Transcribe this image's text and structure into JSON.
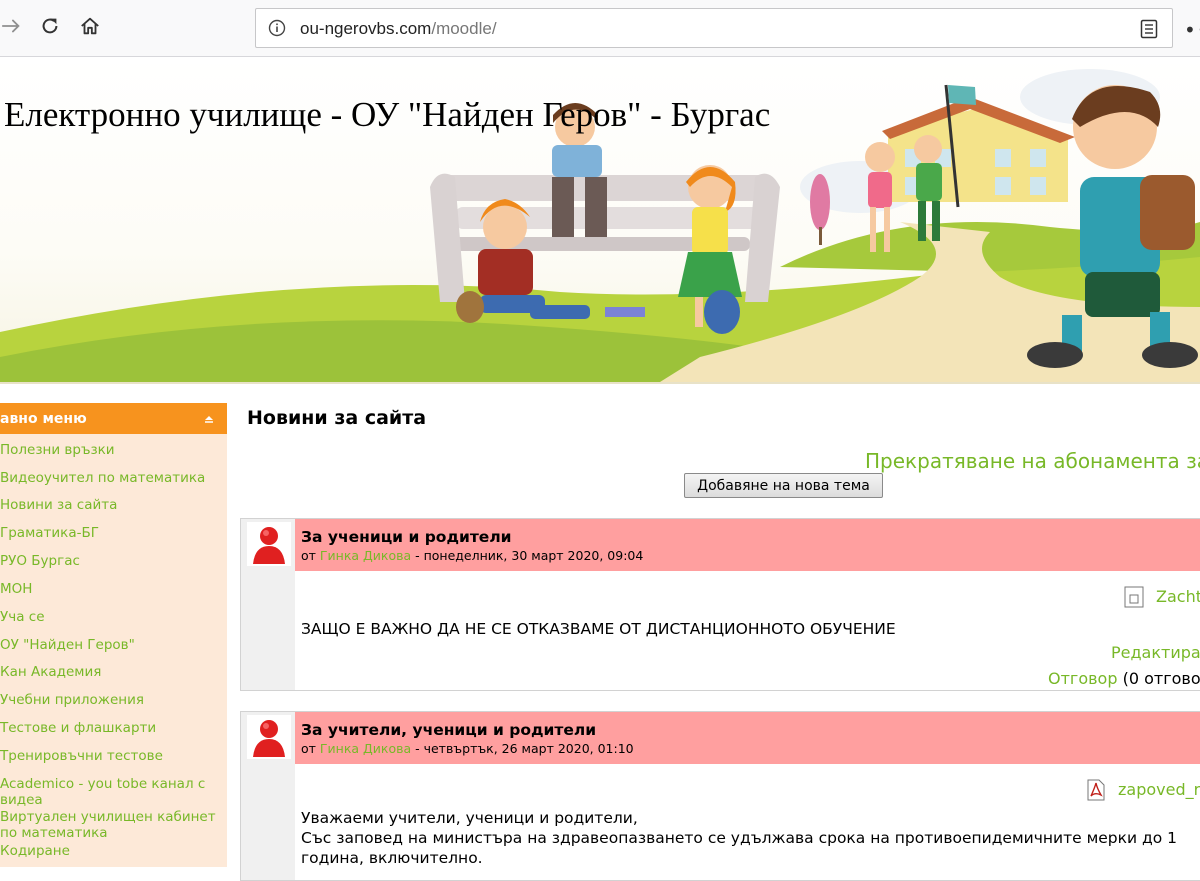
{
  "browser": {
    "url_domain": "ou-ngerovbs.com",
    "url_path": "/moodle/",
    "more_label": "•••"
  },
  "site": {
    "title": "Електронно училище - ОУ \"Найден Геров\" - Бургас"
  },
  "sidebar": {
    "header": "авно меню",
    "items": [
      "Полезни връзки",
      "Видеоучител по математика",
      "Новини за сайта",
      "Граматика-БГ",
      "РУО Бургас",
      "МОН",
      "Уча се",
      "ОУ \"Найден Геров\"",
      "Кан Академия",
      "Учебни приложения",
      "Тестове и флашкарти",
      "Тренировъчни тестове",
      "Academico - you tobe канал с видеа",
      "Виртуален училищен кабинет по математика",
      "Кодиране"
    ]
  },
  "main": {
    "heading": "Новини за сайта",
    "unsubscribe": "Прекратяване на абонамента за",
    "add_topic": "Добавяне на нова тема"
  },
  "posts": [
    {
      "subject": "За ученици и родители",
      "meta_prefix": "от ",
      "author": "Гинка Дикова",
      "meta_suffix": " - понеделник, 30 март 2020, 09:04",
      "attachment": "Zacht",
      "body_lines": [
        "ЗАЩО Е ВАЖНО ДА НЕ СЕ ОТКАЗВАМЕ ОТ ДИСТАНЦИОННОТО ОБУЧЕНИЕ"
      ],
      "edit_label": "Редактира",
      "reply_label": "Отговор",
      "reply_count": " (0 отговор"
    },
    {
      "subject": "За учители, ученици и родители",
      "meta_prefix": "от ",
      "author": "Гинка Дикова",
      "meta_suffix": " - четвъртък, 26 март 2020, 01:10",
      "attachment": "zapoved_r",
      "body_lines": [
        "Уважаеми учители, ученици и родители,",
        "Със заповед на министъра на здравеопазването се удължава срока на противоепидемичните мерки до 1",
        "година, включително."
      ]
    }
  ],
  "colors": {
    "link_green": "#78b828",
    "sidebar_header": "#f7931e",
    "sidebar_bg": "#fde9d8",
    "post_header": "#ff9f9f"
  },
  "icons": {
    "back": "arrow-right-icon",
    "reload": "reload-icon",
    "home": "home-icon",
    "info": "info-icon",
    "reader": "reader-view-icon",
    "avatar": "user-avatar-icon",
    "attachment_generic": "document-icon",
    "attachment_pdf": "pdf-icon"
  }
}
